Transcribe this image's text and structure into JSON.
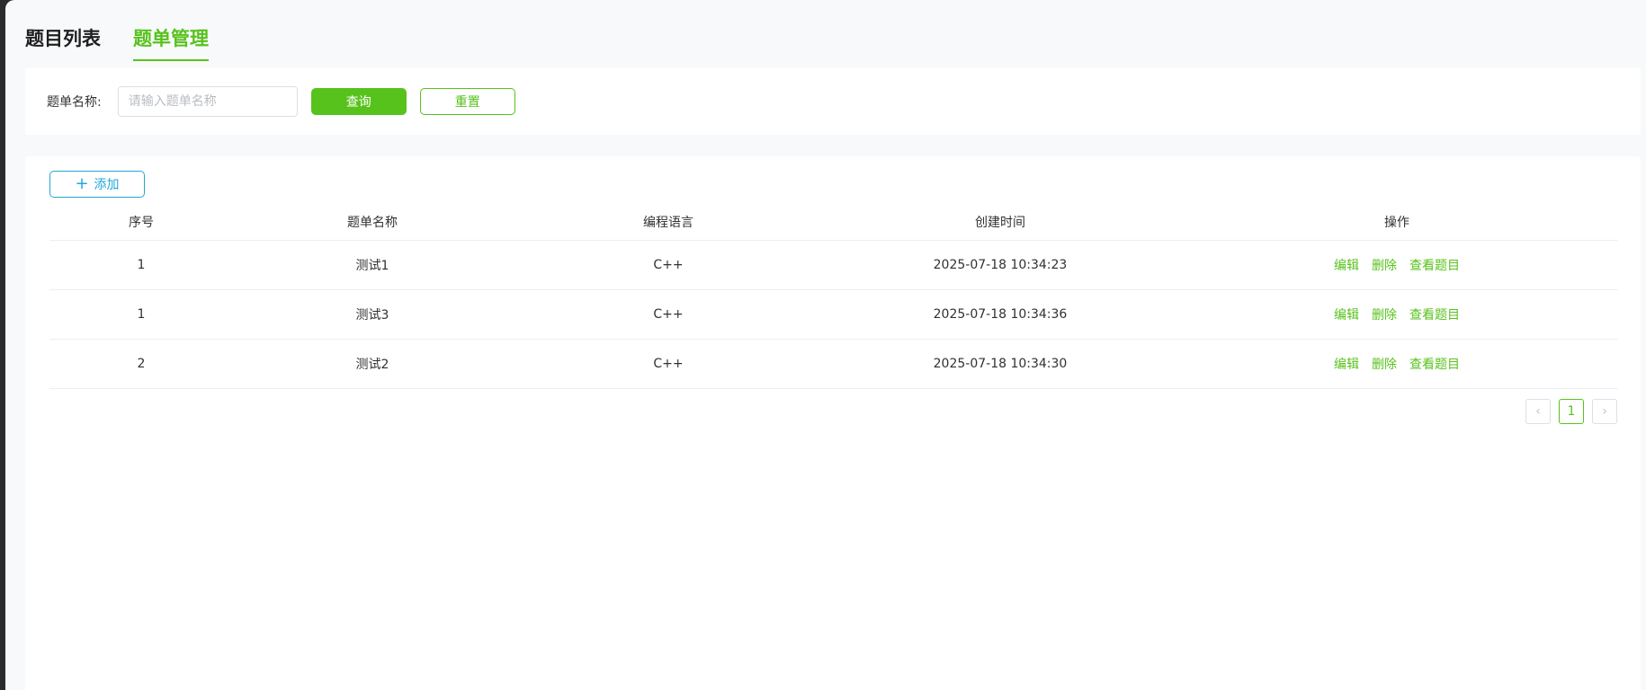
{
  "tabs": [
    {
      "label": "题目列表",
      "active": false
    },
    {
      "label": "题单管理",
      "active": true
    }
  ],
  "search": {
    "label": "题单名称:",
    "placeholder": "请输入题单名称",
    "value": "",
    "query_label": "查询",
    "reset_label": "重置"
  },
  "toolbar": {
    "add_label": "添加"
  },
  "table": {
    "columns": [
      "序号",
      "题单名称",
      "编程语言",
      "创建时间",
      "操作"
    ],
    "rows": [
      {
        "index": "1",
        "name": "测试1",
        "language": "C++",
        "created": "2025-07-18 10:34:23"
      },
      {
        "index": "1",
        "name": "测试3",
        "language": "C++",
        "created": "2025-07-18 10:34:36"
      },
      {
        "index": "2",
        "name": "测试2",
        "language": "C++",
        "created": "2025-07-18 10:34:30"
      }
    ],
    "actions": {
      "edit": "编辑",
      "delete": "删除",
      "view": "查看题目"
    }
  },
  "pagination": {
    "current": "1",
    "prev": "‹",
    "next": "›"
  },
  "colors": {
    "accent": "#58c21c",
    "add_button": "#21a8d8"
  }
}
